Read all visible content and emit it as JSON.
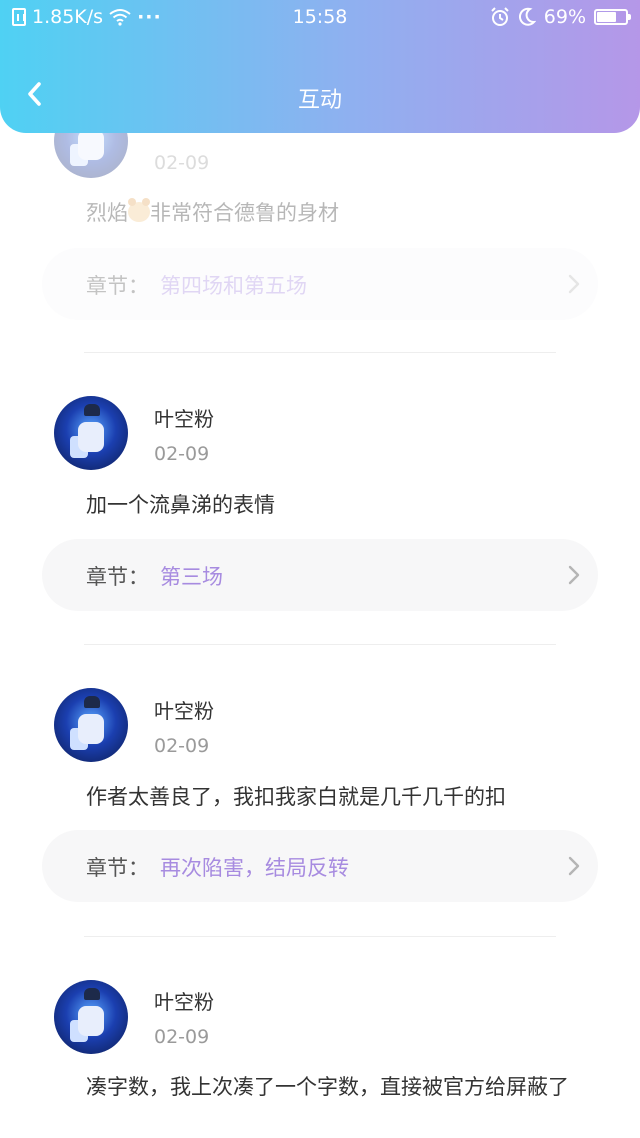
{
  "status_bar": {
    "speed": "1.85K/s",
    "dots": "···",
    "time": "15:58",
    "battery": "69%",
    "battery_level": 0.69
  },
  "nav": {
    "title": "互动"
  },
  "chapter_prefix": "章节：",
  "comments": [
    {
      "date": "02-09",
      "content_before": "烈焰",
      "content_after": "非常符合德鲁的身材",
      "chapter": "第四场和第五场"
    },
    {
      "username": "叶空粉",
      "date": "02-09",
      "content": "加一个流鼻涕的表情",
      "chapter": "第三场"
    },
    {
      "username": "叶空粉",
      "date": "02-09",
      "content": "作者太善良了，我扣我家白就是几千几千的扣",
      "chapter": "再次陷害，结局反转"
    },
    {
      "username": "叶空粉",
      "date": "02-09",
      "content": "凑字数，我上次凑了一个字数，直接被官方给屏蔽了"
    }
  ],
  "colors": {
    "header_gradient_start": "#4fd1f3",
    "header_gradient_end": "#b597e8",
    "chapter_link": "#a78be0"
  }
}
